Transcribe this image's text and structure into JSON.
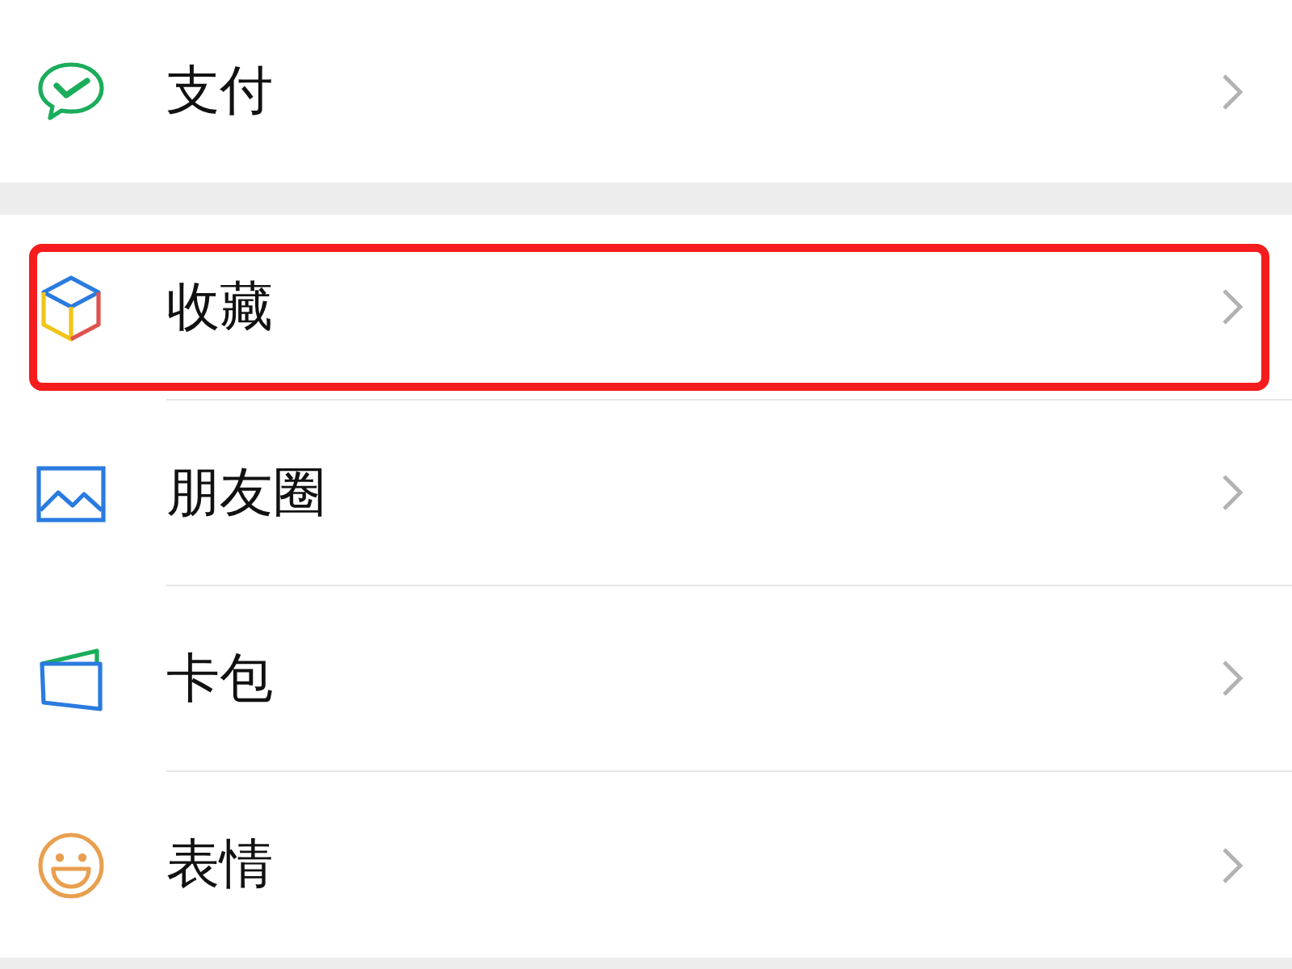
{
  "groups": [
    {
      "items": [
        {
          "kind": "pay",
          "label": "支付",
          "highlighted": false
        }
      ]
    },
    {
      "items": [
        {
          "kind": "favorites",
          "label": "收藏",
          "highlighted": true
        },
        {
          "kind": "moments",
          "label": "朋友圈",
          "highlighted": false
        },
        {
          "kind": "cards",
          "label": "卡包",
          "highlighted": false
        },
        {
          "kind": "stickers",
          "label": "表情",
          "highlighted": false
        }
      ]
    }
  ]
}
